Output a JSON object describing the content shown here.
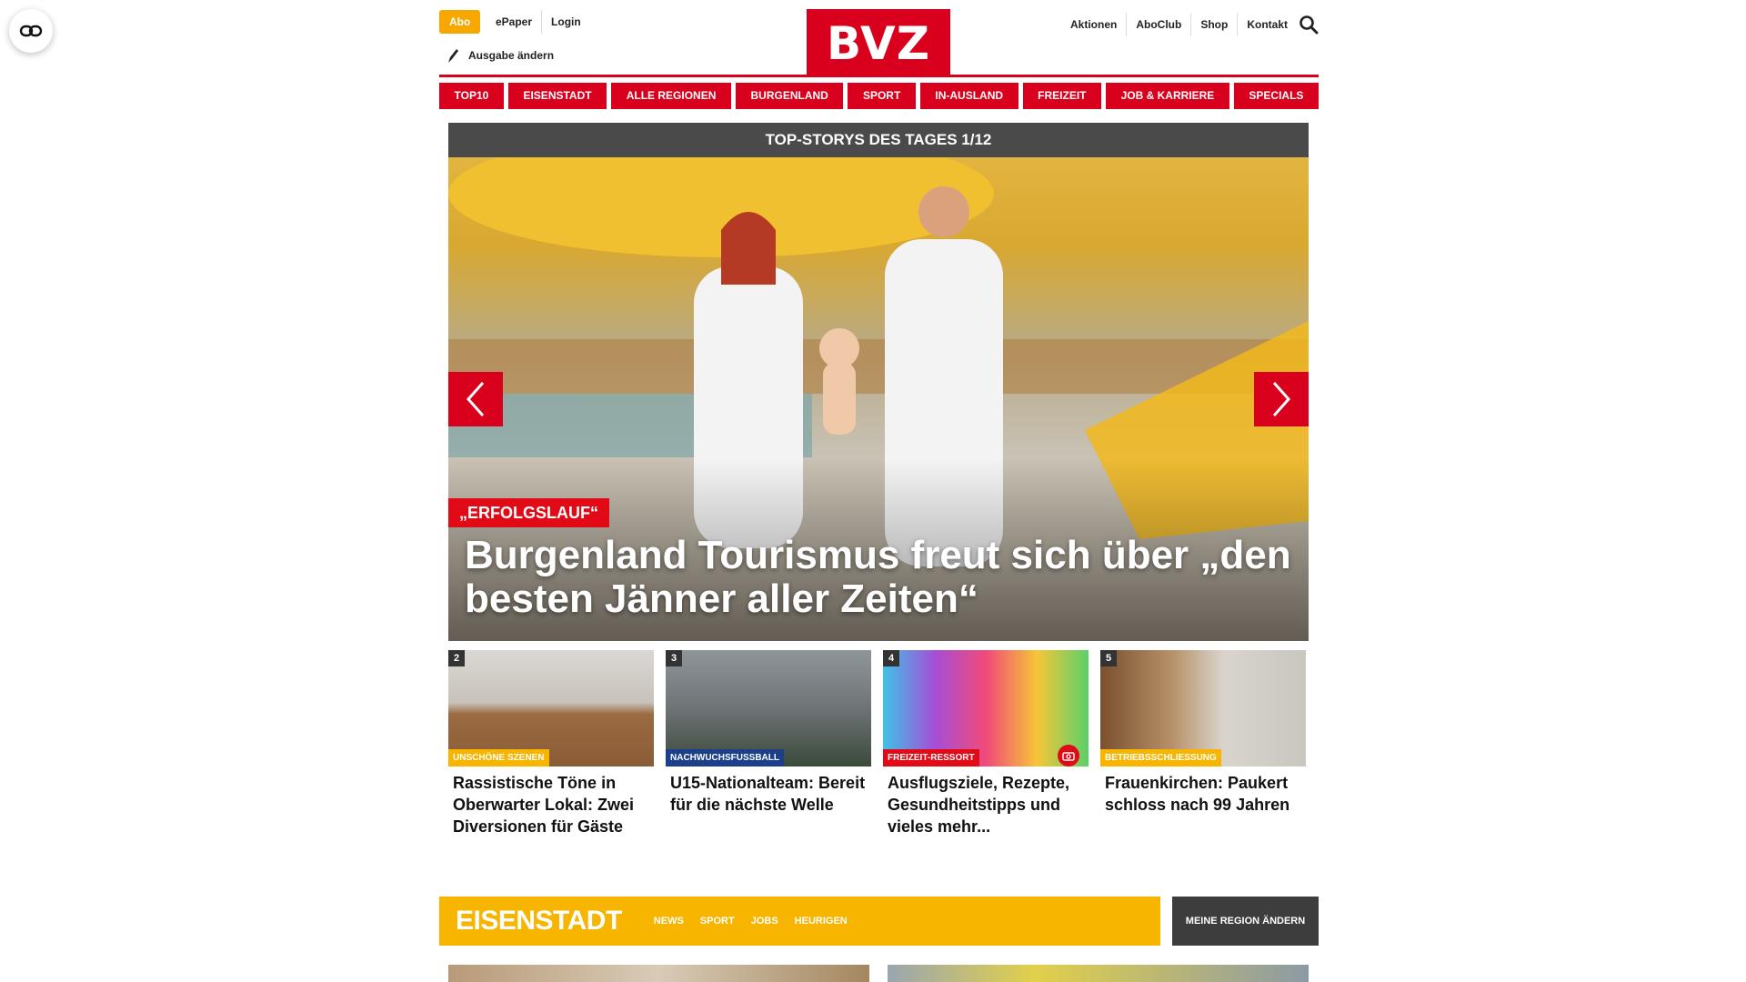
{
  "header": {
    "abo": "Abo",
    "left_links": [
      "ePaper",
      "Login"
    ],
    "edition": "Ausgabe ändern",
    "logo": "BVZ",
    "right_links": [
      "Aktionen",
      "AboClub",
      "Shop",
      "Kontakt"
    ]
  },
  "nav": [
    "TOP10",
    "EISENSTADT",
    "ALLE REGIONEN",
    "BURGENLAND",
    "SPORT",
    "IN-AUSLAND",
    "FREIZEIT",
    "JOB & KARRIERE",
    "SPECIALS"
  ],
  "hero": {
    "bar": "TOP-STORYS DES TAGES 1/12",
    "kicker": "„ERFOLGSLAUF“",
    "title": "Burgenland Tourismus freut sich über „den besten Jänner aller Zeiten“"
  },
  "cards": [
    {
      "num": "2",
      "tag": "UNSCHÖNE SZENEN",
      "tag_color": "#f7b500",
      "title": "Rassistische Töne in Oberwarter Lokal: Zwei Diversionen für Gäste"
    },
    {
      "num": "3",
      "tag": "NACHWUCHSFUSSBALL",
      "tag_color": "#1c3f8c",
      "title": "U15-Nationalteam: Bereit für die nächste Welle"
    },
    {
      "num": "4",
      "tag": "FREIZEIT-RESSORT",
      "tag_color": "#e20a17",
      "title": "Ausflugsziele, Rezepte, Gesundheitstipps und vieles mehr..."
    },
    {
      "num": "5",
      "tag": "BETRIEBSSCHLIESSUNG",
      "tag_color": "#f7b500",
      "title": "Frauenkirchen: Paukert schloss nach 99 Jahren"
    }
  ],
  "region": {
    "name": "EISENSTADT",
    "links": [
      "NEWS",
      "SPORT",
      "JOBS",
      "HEURIGEN"
    ],
    "change_button": "MEINE REGION ÄNDERN"
  },
  "colors": {
    "brand_red": "#d8001d",
    "accent_yellow": "#f7b500"
  },
  "icons": [
    "accessibility-icon",
    "pen-icon",
    "search-icon",
    "chevron-left-icon",
    "chevron-right-icon",
    "camera-icon"
  ]
}
